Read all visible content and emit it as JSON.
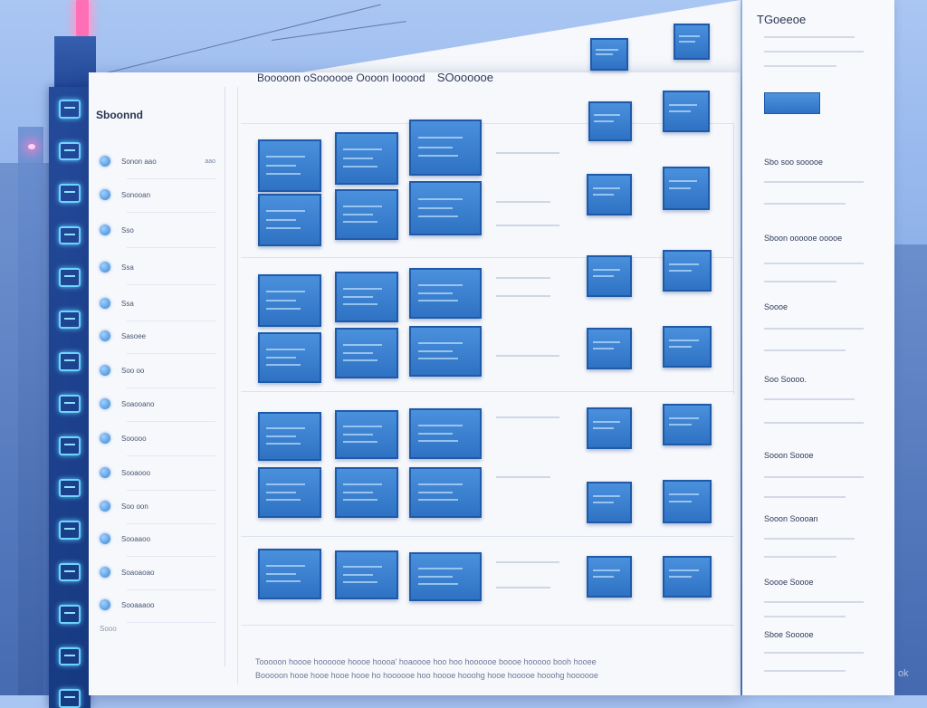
{
  "sidebar": {
    "title": "Sboonnd",
    "items": [
      {
        "label": "Sonon aao",
        "badge": "aao"
      },
      {
        "label": "Sonooan"
      },
      {
        "label": "Sso"
      },
      {
        "label": "Ssa"
      },
      {
        "label": "Ssa"
      },
      {
        "label": "Sasoee"
      },
      {
        "label": "Soo oo"
      },
      {
        "label": "Soaooano"
      },
      {
        "label": "Sooooo"
      },
      {
        "label": "Sooaooo"
      },
      {
        "label": "Soo oon"
      },
      {
        "label": "Sooaaoo"
      },
      {
        "label": "Soaoaoao"
      },
      {
        "label": "Sooaaaoo"
      }
    ],
    "footer": "Sooo"
  },
  "main": {
    "header_primary": "Booooon oSoooooe Oooon Iooood",
    "header_secondary": "SOoooooe"
  },
  "footer": {
    "line1": "Tooooon hoooe hoooooe hoooe hoooa' hoaoooe hoo hoo hoooooe boooe hooooo booh hooee",
    "line2": "Booooon hooe hooe hooe hooe ho hoooooe hoo hoooe hooohg hooe hooooe hooohg hoooooe"
  },
  "right_panel": {
    "title": "TGoeeoe",
    "sections": [
      "Sbo soo sooooe",
      "Sboon oooooe ooooe",
      "Soooe",
      "Soo Soooo.",
      "Sooon Soooe",
      "Sooon Soooan",
      "Soooe Soooe",
      "Sboe Sooooe"
    ]
  },
  "watermark": "ok",
  "colors": {
    "card_fill": "#3a82d2",
    "card_border": "#1f5aa8",
    "panel_bg": "#f6f8fc",
    "rail_bg": "#1d418e",
    "rail_glyph": "#6fd6ff"
  }
}
